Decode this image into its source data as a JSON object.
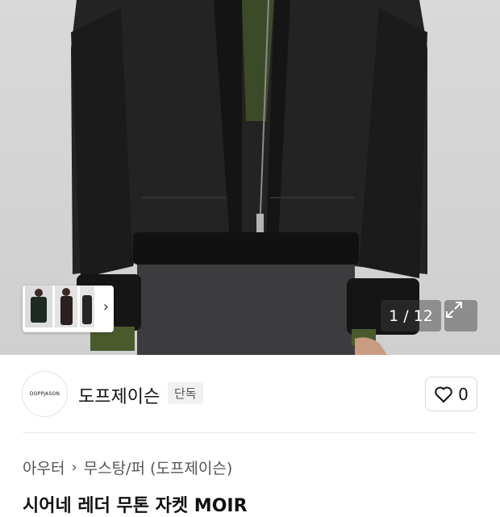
{
  "gallery": {
    "counter": "1 / 12",
    "thumbnail_next": "›"
  },
  "brand": {
    "logo_text": "DOPPJASON",
    "name": "도프제이슨",
    "badge": "단독"
  },
  "like": {
    "count": "0"
  },
  "breadcrumb": {
    "category": "아우터",
    "separator": "›",
    "subcategory": "무스탕/퍼 (도프제이슨)"
  },
  "product": {
    "title": "시어네 레더 무톤 자켓 MOIR"
  }
}
